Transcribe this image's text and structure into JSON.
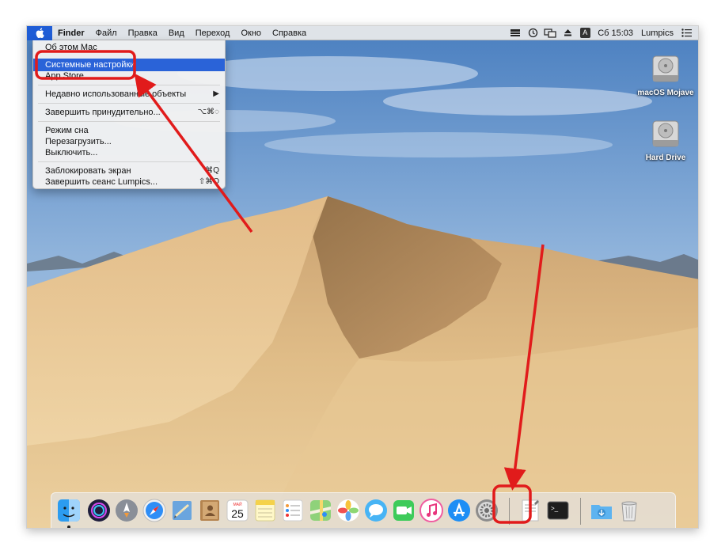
{
  "menubar": {
    "apple_menu_icon": "apple-logo-icon",
    "app_name": "Finder",
    "items": [
      "Файл",
      "Правка",
      "Вид",
      "Переход",
      "Окно",
      "Справка"
    ],
    "status_icons": [
      "bookmark-icon",
      "time-machine-icon",
      "display-mirror-icon",
      "eject-icon",
      "input-source-icon"
    ],
    "input_source_label": "A",
    "clock": "Сб 15:03",
    "user": "Lumpics",
    "notifications_icon": "list-icon"
  },
  "apple_menu": {
    "items": [
      {
        "label": "Об этом Mac",
        "shortcut": ""
      },
      {
        "label": "Системные настройки",
        "shortcut": ""
      },
      {
        "label": "App Store",
        "shortcut": ""
      },
      {
        "label": "Недавно использованные объекты",
        "shortcut": "▶"
      },
      {
        "label": "Завершить принудительно...",
        "shortcut": "⌥⌘◌"
      },
      {
        "label": "Режим сна",
        "shortcut": ""
      },
      {
        "label": "Перезагрузить...",
        "shortcut": ""
      },
      {
        "label": "Выключить...",
        "shortcut": ""
      },
      {
        "label": "Заблокировать экран",
        "shortcut": "⌘Q"
      },
      {
        "label": "Завершить сеанс Lumpics...",
        "shortcut": "⇧⌘Q"
      }
    ],
    "highlighted_index": 1
  },
  "desktop_icons": [
    {
      "label": "macOS Mojave",
      "icon": "hard-drive-icon"
    },
    {
      "label": "Hard Drive",
      "icon": "hard-drive-icon"
    }
  ],
  "calendar_icon": {
    "month": "МАЙ",
    "day": "25"
  },
  "dock": [
    "finder-icon",
    "siri-icon",
    "launchpad-icon",
    "safari-icon",
    "mail-icon",
    "contacts-icon",
    "calendar-icon",
    "notes-icon",
    "reminders-icon",
    "maps-icon",
    "photos-icon",
    "messages-icon",
    "facetime-icon",
    "itunes-icon",
    "app-store-icon",
    "system-preferences-icon",
    "textedit-icon",
    "terminal-icon",
    "downloads-folder-icon",
    "trash-icon"
  ],
  "colors": {
    "highlight": "#2a63d8",
    "annotation": "#e11b1b",
    "menubar": "#ececec",
    "apple_tab": "#1f5dd6"
  }
}
